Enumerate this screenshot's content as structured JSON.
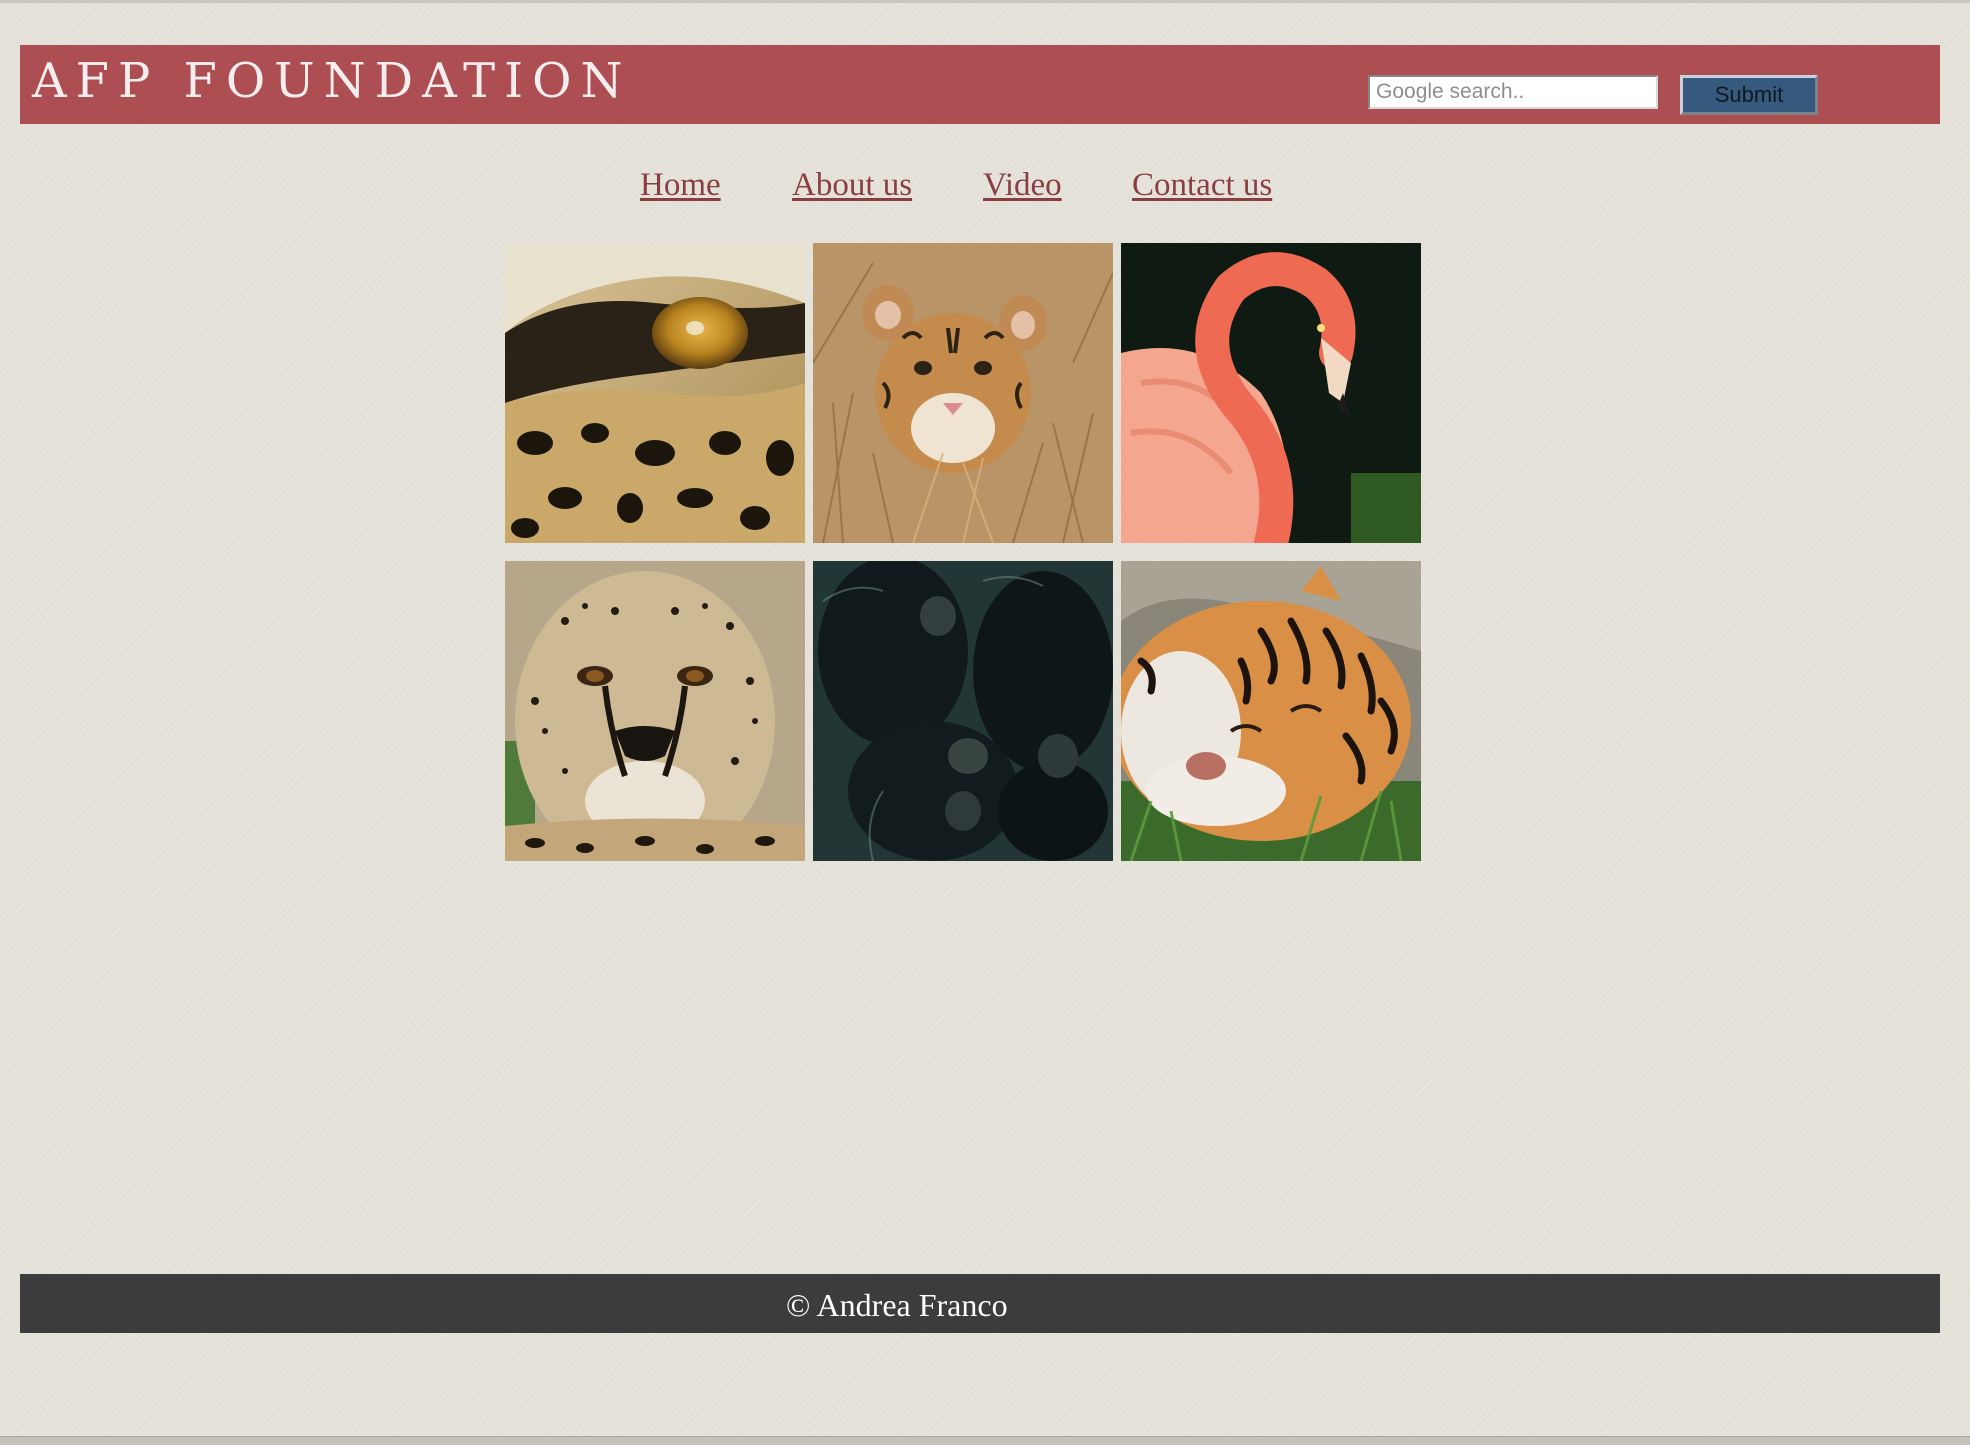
{
  "header": {
    "logo_text": "AFP FOUNDATION",
    "background_color": "#ad4f52",
    "search": {
      "value": "",
      "placeholder": "Google search.."
    },
    "submit_label": "Submit",
    "submit_color": "#355a7d"
  },
  "nav": {
    "link_color": "#8a3e44",
    "links": [
      {
        "label": "Home"
      },
      {
        "label": "About us"
      },
      {
        "label": "Video"
      },
      {
        "label": "Contact us"
      }
    ]
  },
  "gallery": {
    "images": [
      {
        "subject": "leopard eye close-up"
      },
      {
        "subject": "tiger cub in grass"
      },
      {
        "subject": "pink flamingo"
      },
      {
        "subject": "cheetah face"
      },
      {
        "subject": "gorilla family"
      },
      {
        "subject": "sleeping tiger"
      }
    ]
  },
  "footer": {
    "copyright": "© Andrea Franco",
    "background_color": "#3c3c3c"
  }
}
